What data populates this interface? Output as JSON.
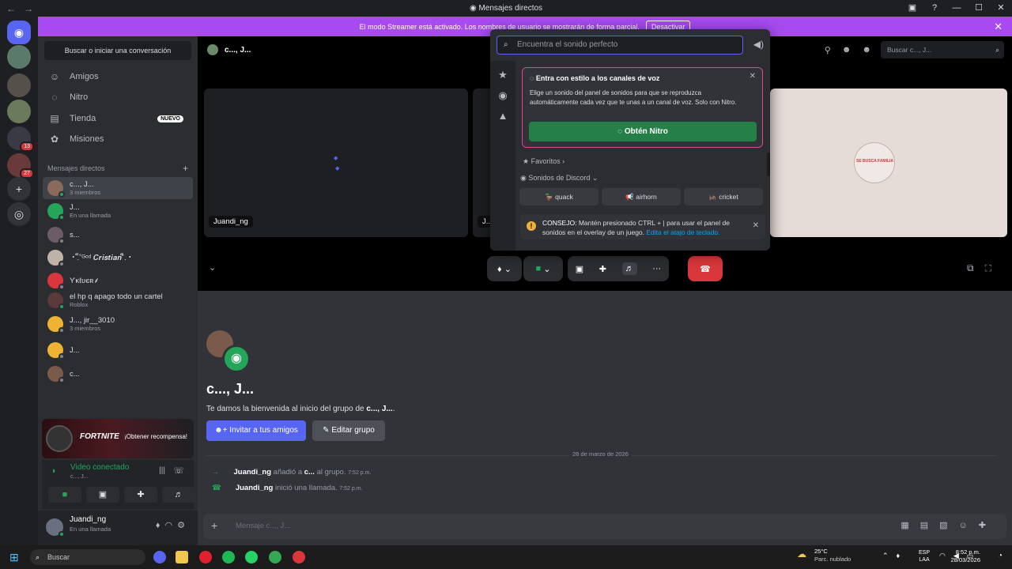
{
  "window": {
    "title": "Mensajes directos",
    "nav_glyphs": "←→",
    "controls": [
      "▣",
      "?",
      "—",
      "☐",
      "✕"
    ]
  },
  "guilds": {
    "badges": [
      "13",
      "27"
    ]
  },
  "banner": {
    "text": "El modo Streamer está activado. Los nombres de usuario se mostrarán de forma parcial.",
    "button": "Desactivar"
  },
  "sidebar": {
    "search_button": "Buscar o iniciar una conversación",
    "nav": [
      {
        "label": "Amigos",
        "icon": "friends-icon"
      },
      {
        "label": "Nitro",
        "icon": "nitro-icon"
      },
      {
        "label": "Tienda",
        "icon": "shop-icon",
        "badge": "NUEVO"
      },
      {
        "label": "Misiones",
        "icon": "quests-icon"
      }
    ],
    "dm_header": "Mensajes directos",
    "dms": [
      {
        "name": "c..., J...",
        "sub": "3 miembros",
        "active": true,
        "color": "#8a6a5a"
      },
      {
        "name": "J...",
        "sub": "En una llamada",
        "color": "#23a55a"
      },
      {
        "name": "s...",
        "sub": "",
        "color": "#6b5c66"
      },
      {
        "name": "・.็˚ᴳᵒᵈ 𝑪𝒓𝒊𝒔𝒕𝒊𝒂𝒏˚็.・",
        "sub": "",
        "color": "#bfb3a8"
      },
      {
        "name": "Ƴĸℓʋєʀ⸙",
        "sub": "",
        "color": "#da373c"
      },
      {
        "name": "el hp q apago todo un cartel",
        "sub": "Roblox",
        "color": "#5a3a3a"
      },
      {
        "name": "J..., jir__3010",
        "sub": "3 miembros",
        "color": "#f0b232"
      },
      {
        "name": "J...",
        "sub": "",
        "color": "#f0b232"
      },
      {
        "name": "c...",
        "sub": "",
        "color": "#7a5a4a"
      }
    ],
    "promo": {
      "game": "FORTNITE",
      "cta": "¡Obtener recompensa!"
    },
    "voice": {
      "status": "Video conectado",
      "channel": "c..., J..."
    },
    "user": {
      "name": "Juandi_ng",
      "status": "En una llamada"
    }
  },
  "main": {
    "header_title": "c..., J...",
    "search_placeholder": "Buscar c..., J...",
    "tiles": [
      {
        "label": "Juandi_ng"
      },
      {
        "label": "J..."
      },
      {
        "label": "SE BUSCA FAMILIA"
      }
    ],
    "group_name": "c..., J...",
    "welcome_prefix": "Te damos la bienvenida al inicio del grupo de ",
    "welcome_name": "c..., J...",
    "welcome_suffix": ".",
    "invite_button": "Invitar a tus amigos",
    "edit_button": "Editar grupo",
    "date_divider": "28 de marzo de 2026",
    "messages": [
      {
        "user": "Juandi_ng",
        "text_pre": "añadió a ",
        "target": "c...",
        "text_post": " al grupo.",
        "time": "7:52 p.m.",
        "icon": "→",
        "icon_color": "#23a55a"
      },
      {
        "user": "Juandi_ng",
        "text_pre": "inició una llamada.",
        "target": "",
        "text_post": "",
        "time": "7:52 p.m.",
        "icon": "☎",
        "icon_color": "#23a55a"
      }
    ],
    "composer_placeholder": "Mensaje c..., J..."
  },
  "soundboard": {
    "search_placeholder": "Encuentra el sonido perfecto",
    "promo_title": "Entra con estilo a los canales de voz",
    "promo_desc": "Elige un sonido del panel de sonidos para que se reproduzca automáticamente cada vez que te unas a un canal de voz. Solo con Nitro.",
    "promo_button": "Obtén Nitro",
    "favorites": "Favoritos",
    "discord_sounds": "Sonidos de Discord",
    "sounds": [
      {
        "label": "quack",
        "emoji": "🦆"
      },
      {
        "label": "airhorn",
        "emoji": "📢"
      },
      {
        "label": "cricket",
        "emoji": "🦗"
      }
    ],
    "tip_label": "CONSEJO:",
    "tip_text": " Mantén presionado CTRL + | para usar el panel de sonidos en el overlay de un juego. ",
    "tip_link": "Edita el atajo de teclado."
  },
  "taskbar": {
    "search": "Buscar",
    "weather_temp": "25°C",
    "weather_desc": "Parc. nublado",
    "lang": "ESP",
    "lang2": "LAA",
    "time": "8:52 p.m.",
    "date": "28/03/2026"
  }
}
